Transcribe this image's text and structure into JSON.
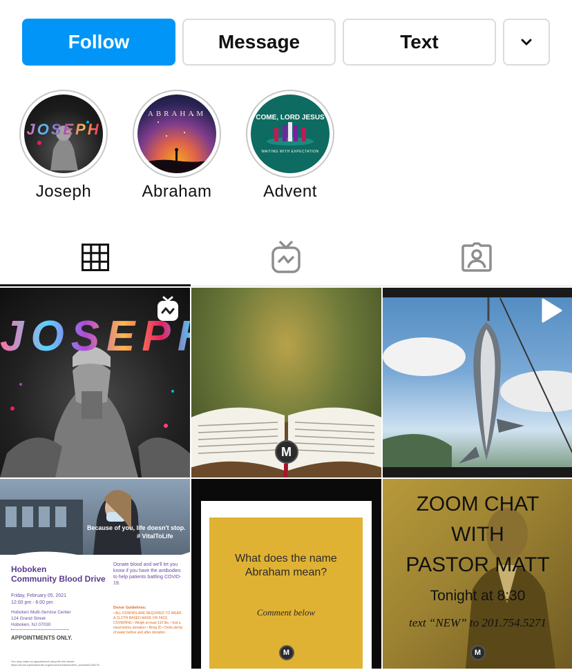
{
  "actions": {
    "follow": "Follow",
    "message": "Message",
    "text": "Text"
  },
  "highlights": [
    {
      "label": "Joseph",
      "cover_text": "JOSEPH"
    },
    {
      "label": "Abraham",
      "cover_text": "ABRAHAM"
    },
    {
      "label": "Advent",
      "cover_text": "COME, LORD JESUS",
      "cover_subtext": "WAITING WITH EXPECTATION"
    }
  ],
  "tabs": [
    {
      "name": "posts",
      "icon": "grid-icon",
      "selected": true
    },
    {
      "name": "igtv",
      "icon": "igtv-icon",
      "selected": false
    },
    {
      "name": "tagged",
      "icon": "tagged-icon",
      "selected": false
    }
  ],
  "posts": [
    {
      "title_text": "JOSEPH",
      "badge": "igtv-icon"
    },
    {
      "mark": "M"
    },
    {
      "badge": "play-icon"
    },
    {
      "overlay_line1": "Because of you, life doesn't stop.",
      "overlay_line2": "# VitalToLife",
      "heading_line1": "Hoboken",
      "heading_line2": "Community Blood Drive",
      "side_text": "Donate blood and we'll let you know if you have the antibodies to help patients battling COVID-19.",
      "date": "Friday, February 05, 2021",
      "time": "12:00 pm - 6:00 pm",
      "venue_line1": "Hoboken Multi-Service Center",
      "venue_line2": "124 Grand Street",
      "venue_line3": "Hoboken, NJ 07030",
      "guidelines_title": "Donor Guidelines:",
      "guidelines": "• ALL DONORS ARE REQUIRED TO WEAR A CLOTH BASED MASK OR FACE COVERING • Weigh at least 110 lbs. • Eat a meal before donation • Bring ID • Drink plenty of water before and after donation",
      "appointments": "APPOINTMENTS ONLY.",
      "footnote": "You may make an appointment using the link below: https://donor.nybloodcenter.org/donor/schedules/drive_schedule/155176"
    },
    {
      "question": "What does the name Abraham mean?",
      "comment": "Comment below",
      "mark": "M"
    },
    {
      "line1": "ZOOM CHAT",
      "line2": "WITH",
      "line3": "PASTOR MATT",
      "line4": "Tonight at 8:30",
      "line5": "text “NEW” to 201.754.5271",
      "mark": "M"
    }
  ]
}
